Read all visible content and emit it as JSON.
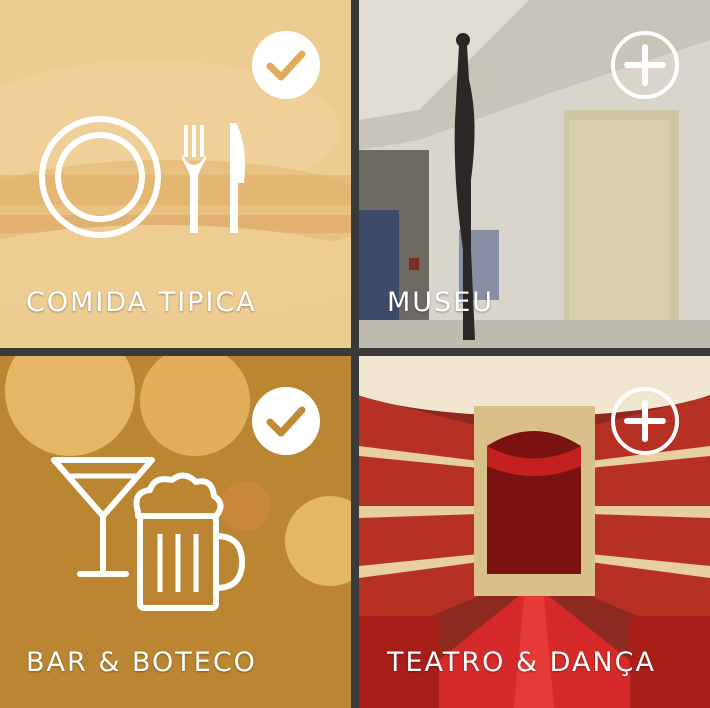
{
  "tiles": [
    {
      "id": "comida",
      "label": "COMIDA TIPICA",
      "state": "selected",
      "icon": "plate-cutlery-icon"
    },
    {
      "id": "museu",
      "label": "MUSEU",
      "state": "unselected",
      "icon": "plus-icon"
    },
    {
      "id": "bar",
      "label": "BAR & BOTECO",
      "state": "selected",
      "icon": "cocktail-beer-icon"
    },
    {
      "id": "teatro",
      "label": "TEATRO & DANÇA",
      "state": "unselected",
      "icon": "plus-icon"
    }
  ],
  "colors": {
    "selected_overlay": "#e8b86a",
    "bar_overlay": "#c8903a",
    "divider": "#3a3a3a",
    "white": "#ffffff"
  }
}
